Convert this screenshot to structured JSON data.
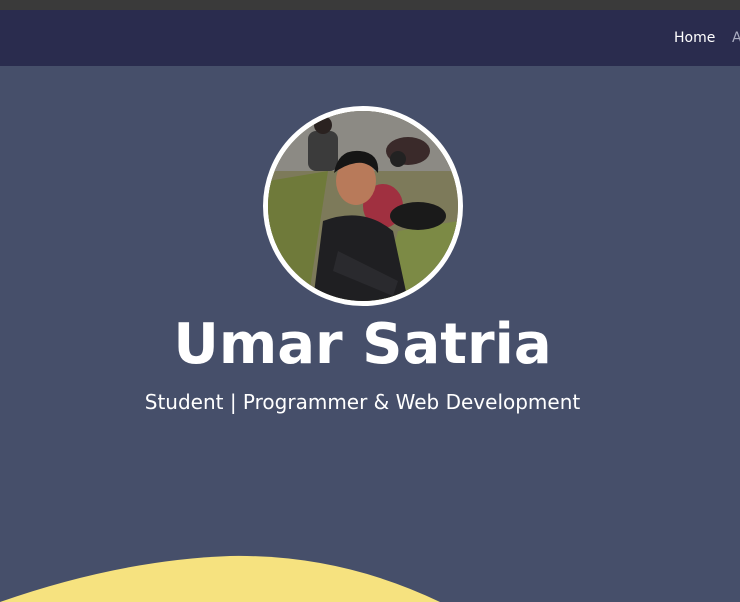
{
  "nav": {
    "items": [
      {
        "label": "Home"
      },
      {
        "label": "A"
      }
    ]
  },
  "hero": {
    "name": "Umar Satria",
    "tagline": "Student | Programmer & Web Development",
    "avatar_icon": "profile-photo"
  },
  "colors": {
    "navbar": "#2a2c4e",
    "hero_bg": "#464f6a",
    "wave": "#f6e27f",
    "text": "#ffffff"
  }
}
